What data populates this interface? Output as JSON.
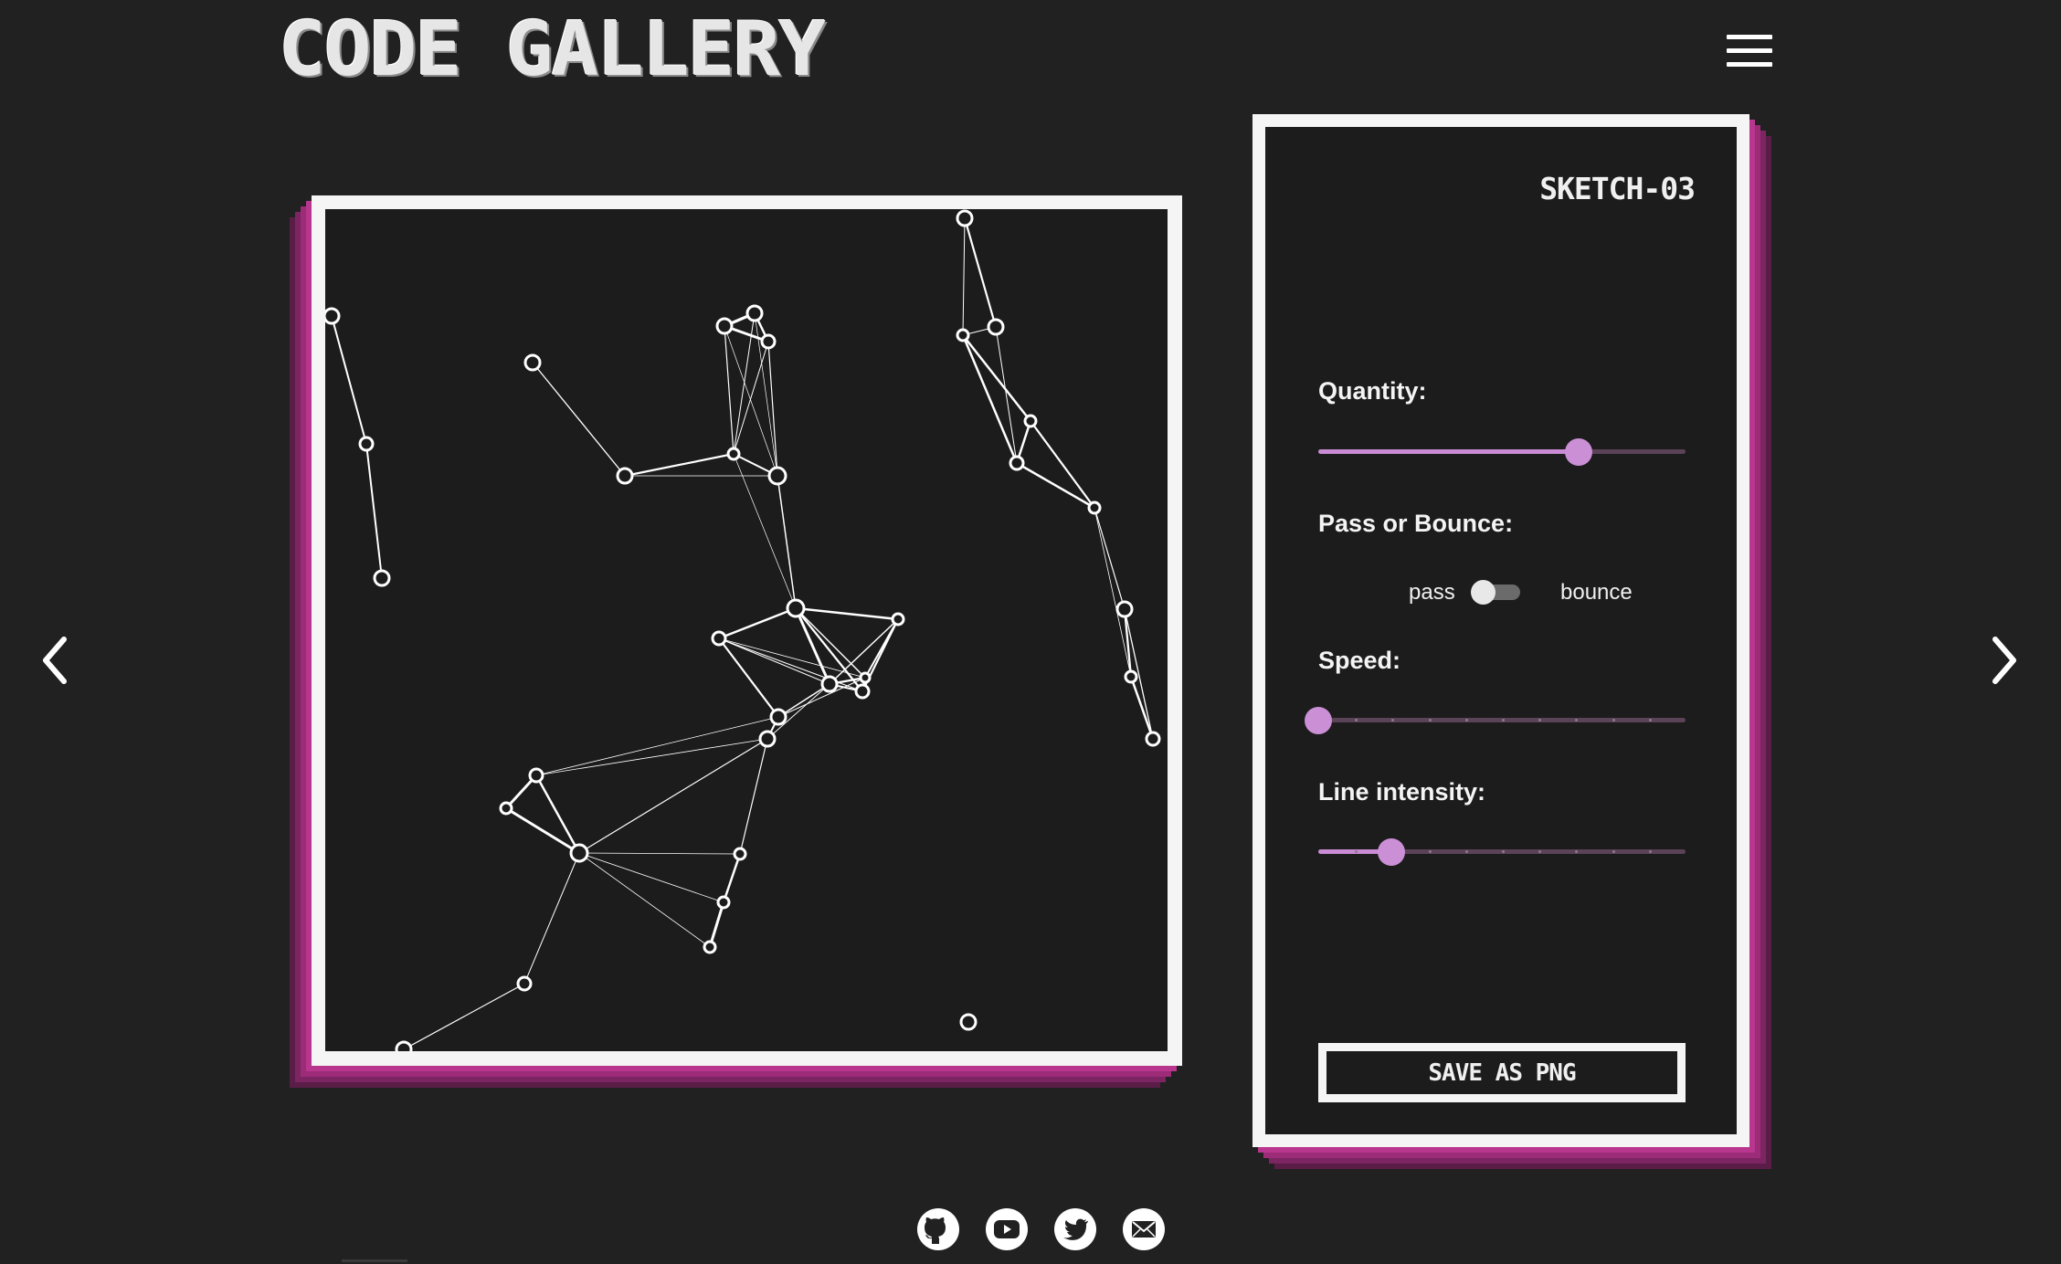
{
  "header": {
    "logo_text": "CODE GALLERY",
    "menu_icon": "hamburger-menu-icon"
  },
  "navigation": {
    "prev_icon": "chevron-left-icon",
    "next_icon": "chevron-right-icon"
  },
  "sketch": {
    "title": "SKETCH-03",
    "node_color": "#ffffff",
    "background": "#1c1c1c"
  },
  "controls": {
    "quantity": {
      "label": "Quantity:",
      "value_fraction": 0.71
    },
    "pass_or_bounce": {
      "label": "Pass or Bounce:",
      "left_option": "pass",
      "right_option": "bounce",
      "selected": "pass"
    },
    "speed": {
      "label": "Speed:",
      "value_fraction": 0.0
    },
    "line_intensity": {
      "label": "Line intensity:",
      "value_fraction": 0.2
    },
    "save_label": "SAVE AS PNG"
  },
  "socials": [
    {
      "name": "github",
      "icon": "github-icon"
    },
    {
      "name": "youtube",
      "icon": "youtube-icon"
    },
    {
      "name": "twitter",
      "icon": "twitter-icon"
    },
    {
      "name": "email",
      "icon": "mail-icon"
    }
  ],
  "colors": {
    "accent": "#c98bd4",
    "frame_shadow": "#b8368e",
    "page_bg": "#212121"
  }
}
